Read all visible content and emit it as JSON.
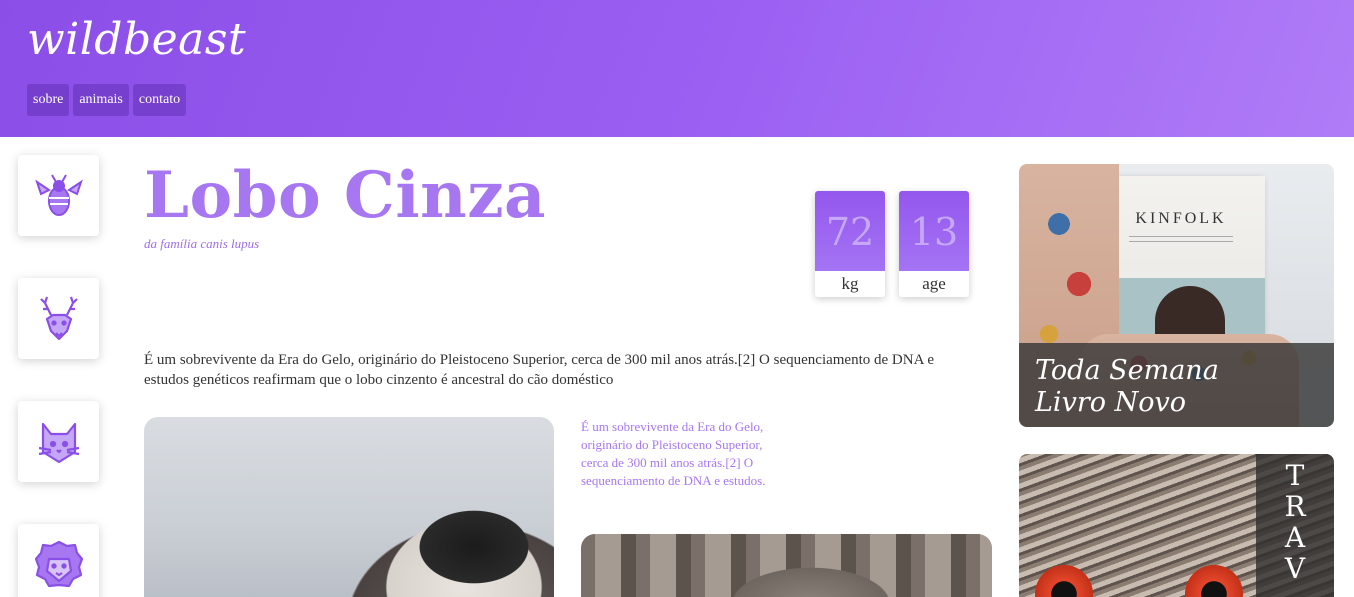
{
  "header": {
    "brand": "wildbeast",
    "nav": [
      {
        "label": "sobre"
      },
      {
        "label": "animais"
      },
      {
        "label": "contato"
      }
    ]
  },
  "sidebar": {
    "icons": [
      "bee-icon",
      "deer-icon",
      "cat-icon",
      "lion-icon"
    ]
  },
  "main": {
    "title": "Lobo Cinza",
    "subtitle": "da família canis lupus",
    "stats": [
      {
        "value": "72",
        "unit": "kg"
      },
      {
        "value": "13",
        "unit": "age"
      }
    ],
    "intro": "É um sobrevivente da Era do Gelo, originário do Pleistoceno Superior, cerca de 300 mil anos atrás.[2] O sequenciamento de DNA e estudos genéticos reafirmam que o lobo cinzento é ancestral do cão doméstico",
    "side_note": "É um sobrevivente da Era do Gelo, originário do Pleistoceno Superior, cerca de 300 mil anos atrás.[2] O sequenciamento de DNA e estudos."
  },
  "aside": {
    "book_card": {
      "magazine_title": "KINFOLK",
      "caption_line1": "Toda Semana",
      "caption_line2": "Livro Novo"
    },
    "owl_card": {
      "letters": [
        "T",
        "R",
        "A",
        "V"
      ]
    }
  },
  "colors": {
    "accent": "#a777f2",
    "header_start": "#8b4fe8",
    "header_end": "#b07cf7"
  }
}
